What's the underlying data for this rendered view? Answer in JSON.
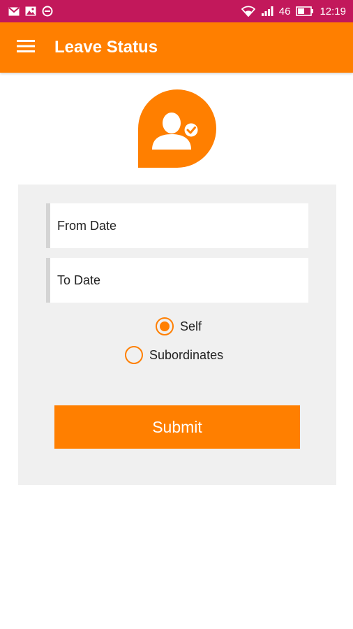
{
  "status_bar": {
    "left_icons": [
      "gmail-icon",
      "gallery-icon",
      "blocked-icon"
    ],
    "network": "46",
    "time": "12:19",
    "bar_color": "#c2185b"
  },
  "app_bar": {
    "title": "Leave Status",
    "color": "#ff7f00"
  },
  "form": {
    "from_date_placeholder": "From Date",
    "to_date_placeholder": "To Date",
    "radio_options": [
      {
        "label": "Self",
        "selected": true
      },
      {
        "label": "Subordinates",
        "selected": false
      }
    ],
    "submit_label": "Submit"
  }
}
